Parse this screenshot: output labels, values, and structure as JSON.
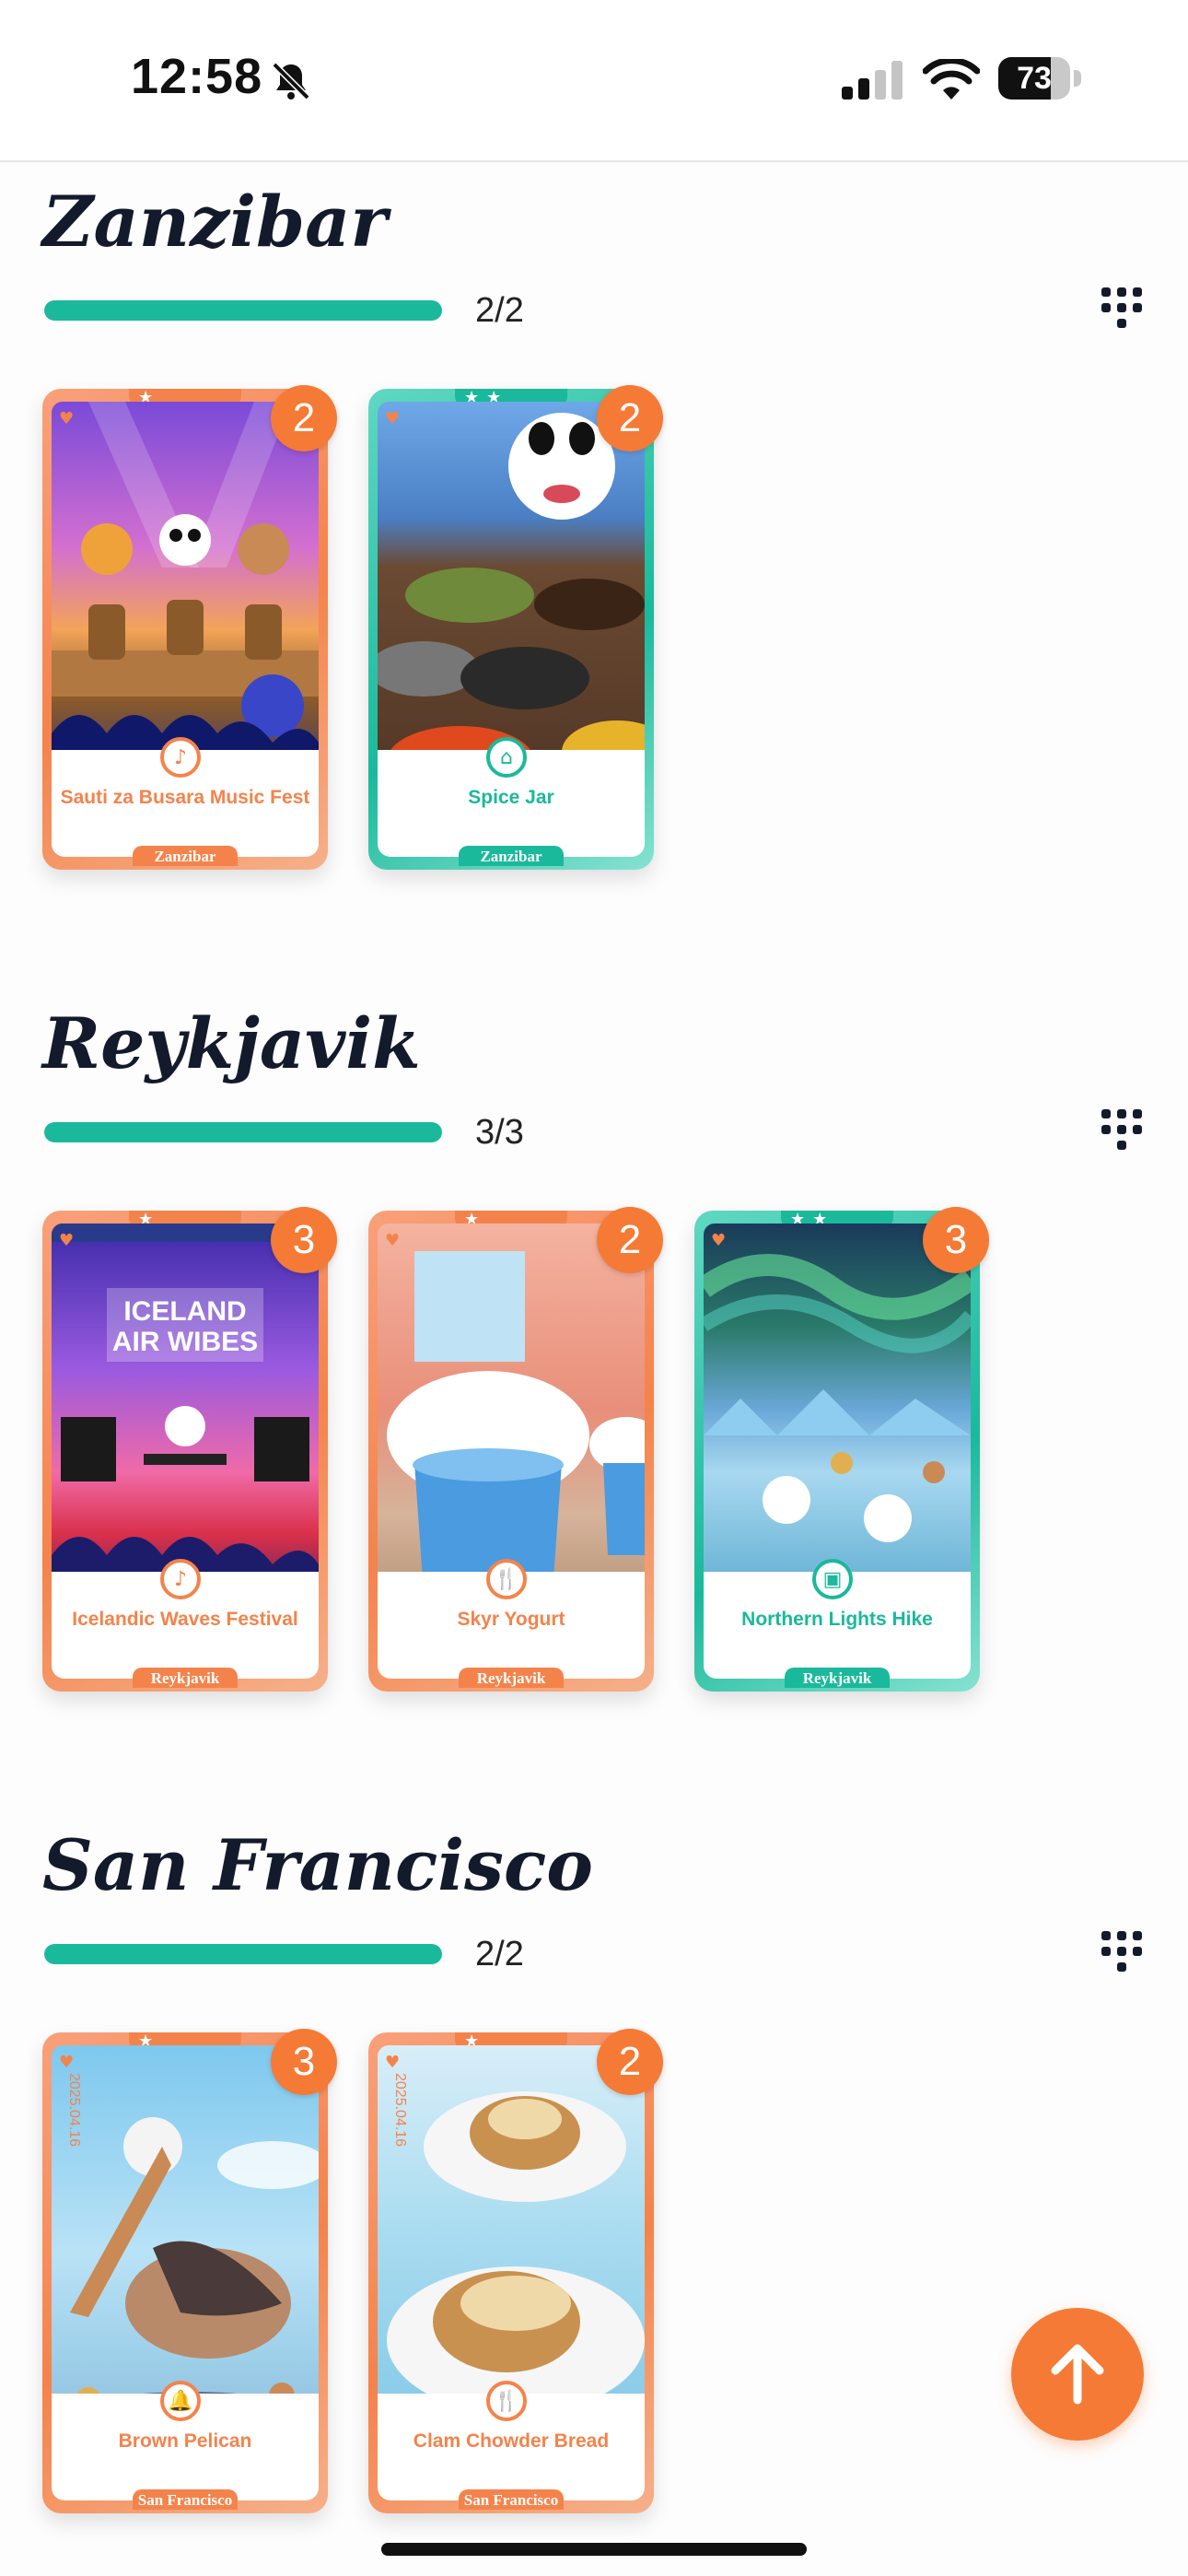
{
  "status": {
    "time": "12:58",
    "battery": "73",
    "battery_level": 0.73
  },
  "sections": [
    {
      "title": "Zanzibar",
      "progress_text": "2/2",
      "progress": 1.0,
      "cards": [
        {
          "name": "Sauti za Busara Music Fest",
          "city": "Zanzibar",
          "count": "2",
          "category_icon": "music-note-icon",
          "theme": "orange",
          "stars": "★"
        },
        {
          "name": "Spice Jar",
          "city": "Zanzibar",
          "count": "2",
          "category_icon": "spice-icon",
          "theme": "teal",
          "stars": "★★"
        }
      ]
    },
    {
      "title": "Reykjavik",
      "progress_text": "3/3",
      "progress": 1.0,
      "cards": [
        {
          "name": "Icelandic Waves Festival",
          "city": "Reykjavik",
          "count": "3",
          "category_icon": "music-note-icon",
          "theme": "orange",
          "stars": "★",
          "art_text": "ICELAND AIR WIBES"
        },
        {
          "name": "Skyr Yogurt",
          "city": "Reykjavik",
          "count": "2",
          "category_icon": "fork-knife-icon",
          "theme": "orange",
          "stars": "★"
        },
        {
          "name": "Northern Lights Hike",
          "city": "Reykjavik",
          "count": "3",
          "category_icon": "landmark-icon",
          "theme": "teal",
          "stars": "★★"
        }
      ]
    },
    {
      "title": "San Francisco",
      "progress_text": "2/2",
      "progress": 1.0,
      "cards": [
        {
          "name": "Brown Pelican",
          "city": "San Francisco",
          "count": "3",
          "category_icon": "animal-icon",
          "theme": "orange",
          "stars": "★",
          "date": "2025.04.16"
        },
        {
          "name": "Clam Chowder Bread",
          "city": "San Francisco",
          "count": "2",
          "category_icon": "fork-knife-icon",
          "theme": "orange",
          "stars": "★",
          "date": "2025.04.16"
        }
      ]
    }
  ],
  "colors": {
    "accent": "#f57a35",
    "progress": "#1ab99b",
    "title": "#131a2b"
  }
}
